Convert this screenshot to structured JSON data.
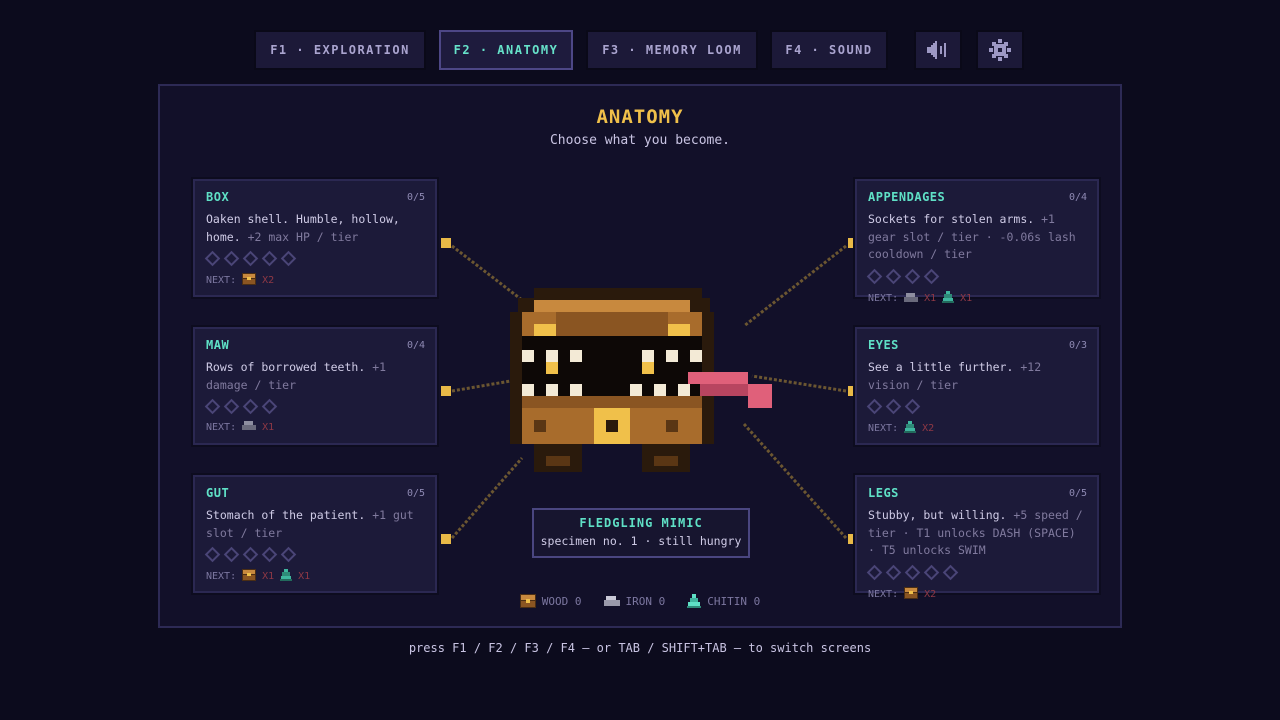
{
  "nav": {
    "tabs": [
      {
        "label": "F1 · EXPLORATION",
        "active": false
      },
      {
        "label": "F2 · ANATOMY",
        "active": true
      },
      {
        "label": "F3 · MEMORY LOOM",
        "active": false
      },
      {
        "label": "F4 · SOUND",
        "active": false
      }
    ],
    "icons": [
      "speaker-icon",
      "gear-icon"
    ]
  },
  "screen": {
    "title": "ANATOMY",
    "subtitle": "Choose what you become."
  },
  "parts": [
    {
      "id": "box",
      "name": "BOX",
      "level": "0/5",
      "tiers": 5,
      "desc": "Oaken shell. Humble, hollow, home.",
      "effect": "+2 max HP / tier",
      "next_label": "NEXT:",
      "costs": [
        {
          "resource": "wood",
          "amount": "X2"
        }
      ]
    },
    {
      "id": "maw",
      "name": "MAW",
      "level": "0/4",
      "tiers": 4,
      "desc": "Rows of borrowed teeth.",
      "effect": "+1 damage / tier",
      "next_label": "NEXT:",
      "costs": [
        {
          "resource": "iron",
          "amount": "X1"
        }
      ]
    },
    {
      "id": "gut",
      "name": "GUT",
      "level": "0/5",
      "tiers": 5,
      "desc": "Stomach of the patient.",
      "effect": "+1 gut slot / tier",
      "next_label": "NEXT:",
      "costs": [
        {
          "resource": "wood",
          "amount": "X1"
        },
        {
          "resource": "chitin",
          "amount": "X1"
        }
      ]
    },
    {
      "id": "appendages",
      "name": "APPENDAGES",
      "level": "0/4",
      "tiers": 4,
      "desc": "Sockets for stolen arms.",
      "effect": "+1 gear slot / tier · -0.06s lash cooldown / tier",
      "next_label": "NEXT:",
      "costs": [
        {
          "resource": "iron",
          "amount": "X1"
        },
        {
          "resource": "chitin",
          "amount": "X1"
        }
      ]
    },
    {
      "id": "eyes",
      "name": "EYES",
      "level": "0/3",
      "tiers": 3,
      "desc": "See a little further.",
      "effect": "+12 vision / tier",
      "next_label": "NEXT:",
      "costs": [
        {
          "resource": "chitin",
          "amount": "X2"
        }
      ]
    },
    {
      "id": "legs",
      "name": "LEGS",
      "level": "0/5",
      "tiers": 5,
      "desc": "Stubby, but willing.",
      "effect": "+5 speed / tier · T1 unlocks DASH (SPACE) · T5 unlocks SWIM",
      "next_label": "NEXT:",
      "costs": [
        {
          "resource": "wood",
          "amount": "X2"
        }
      ]
    }
  ],
  "creature": {
    "name": "FLEDGLING MIMIC",
    "caption": "specimen no. 1 · still hungry"
  },
  "resources": [
    {
      "id": "wood",
      "label": "WOOD 0"
    },
    {
      "id": "iron",
      "label": "IRON 0"
    },
    {
      "id": "chitin",
      "label": "CHITIN 0"
    }
  ],
  "hint": "press F1 / F2 / F3 / F4 — or TAB / SHIFT+TAB — to switch screens",
  "colors": {
    "accent": "#5fe0c6",
    "gold": "#f0c04a",
    "cost": "#8e3845",
    "panel": "#121029"
  }
}
